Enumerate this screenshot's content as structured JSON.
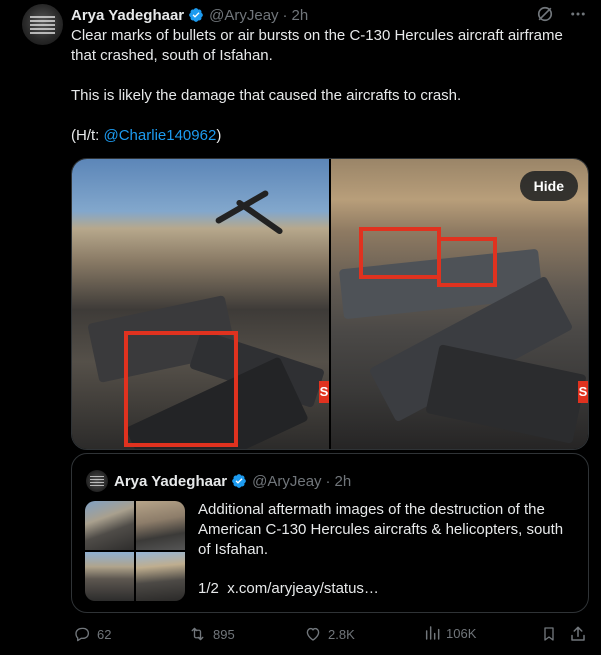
{
  "author": {
    "name": "Arya Yadeghaar",
    "handle": "@AryJeay",
    "separator": "·",
    "time": "2h"
  },
  "post": {
    "line1": "Clear marks of bullets or air bursts on the C-130 Hercules aircraft airframe that crashed, south of Isfahan.",
    "line2": "This is likely the damage that caused the aircrafts to crash.",
    "ht_prefix": "(H/t: ",
    "ht_link": "@Charlie140962",
    "ht_suffix": ")"
  },
  "media": {
    "hide_label": "Hide",
    "watermark_left": "S",
    "watermark_right": "S"
  },
  "quote": {
    "name": "Arya Yadeghaar",
    "handle": "@AryJeay",
    "separator": "·",
    "time": "2h",
    "text": "Additional aftermath images of the destruction of the American C-130 Hercules aircrafts & helicopters, south of Isfahan.",
    "page": "1/2",
    "link": "x.com/aryjeay/status…"
  },
  "actions": {
    "replies": "62",
    "reposts": "895",
    "likes": "2.8K",
    "views": "106K"
  },
  "icons": {
    "verified": "verified-badge-icon",
    "grok": "grok-icon",
    "more": "more-dots-icon",
    "reply": "reply-icon",
    "repost": "repost-icon",
    "like": "heart-icon",
    "views": "views-chart-icon",
    "bookmark": "bookmark-icon",
    "share": "share-icon"
  },
  "colors": {
    "background": "#000000",
    "text": "#e7e9ea",
    "muted": "#71767b",
    "link": "#1d9bf0",
    "verified": "#1d9bf0",
    "highlight_box": "#e0321f"
  }
}
